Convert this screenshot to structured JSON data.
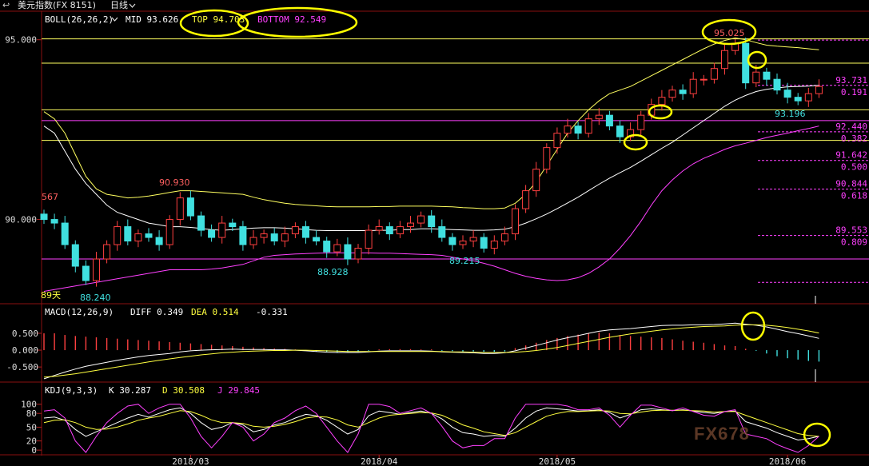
{
  "title_bar": {
    "back_glyph": "↩",
    "instrument": "美元指数(FX 8151)",
    "period": "日线",
    "period_chevron": "chevron-down-icon"
  },
  "watermark": "FX678",
  "chart_data": [
    {
      "type": "candlestick",
      "indicator": "BOLL(26,26,2)",
      "header": {
        "label": "BOLL(26,26,2)",
        "mid_label": "MID 93.626",
        "top_label": "TOP 94.703",
        "bottom_label": "BOTTOM 92.549"
      },
      "y_ticks": [
        "95.000",
        "90.000"
      ],
      "y_tick_values": [
        95.0,
        90.0
      ],
      "ylim": [
        87.7,
        95.75
      ],
      "x_ticks": [
        "2018/03",
        "2018/04",
        "2018/05",
        "2018/06"
      ],
      "x_tick_index": [
        14,
        32,
        49,
        71
      ],
      "bar_count": 75,
      "annotations": [
        {
          "text": "567",
          "value": 89.567,
          "color": "#ff6060"
        },
        {
          "text": "90.930",
          "value": 90.93,
          "color": "#ff6060"
        },
        {
          "text": "88.240",
          "value": 88.24,
          "color": "#40e0e0"
        },
        {
          "text": "88.928",
          "value": 88.928,
          "color": "#40e0e0"
        },
        {
          "text": "89.215",
          "value": 89.215,
          "color": "#40e0e0"
        },
        {
          "text": "95.025",
          "value": 95.025,
          "color": "#ff6060"
        },
        {
          "text": "93.196",
          "value": 93.196,
          "color": "#40e0e0"
        },
        {
          "text": "89天",
          "color": "#ffff40"
        }
      ],
      "horizontal_lines": [
        {
          "value": 95.025,
          "color": "#ffff60"
        },
        {
          "value": 94.35,
          "color": "#ffff60"
        },
        {
          "value": 93.05,
          "color": "#ffff60"
        },
        {
          "value": 92.75,
          "color": "#ff40ff"
        },
        {
          "value": 92.2,
          "color": "#ffff60"
        },
        {
          "value": 88.9,
          "color": "#ff40ff"
        }
      ],
      "fib_levels": [
        {
          "price": "93.731",
          "ratio": "0.191",
          "value": 93.731
        },
        {
          "price": "92.440",
          "ratio": "0.382",
          "value": 92.44
        },
        {
          "price": "91.642",
          "ratio": "0.500",
          "value": 91.642
        },
        {
          "price": "90.844",
          "ratio": "0.618",
          "value": 90.844
        },
        {
          "price": "89.553",
          "ratio": "0.809",
          "value": 89.553
        }
      ],
      "closes": [
        90.0,
        89.9,
        89.3,
        88.7,
        88.3,
        88.9,
        89.3,
        89.8,
        89.4,
        89.6,
        89.5,
        89.3,
        90.0,
        90.6,
        90.1,
        89.7,
        89.5,
        89.9,
        89.8,
        89.3,
        89.5,
        89.6,
        89.4,
        89.6,
        89.8,
        89.5,
        89.4,
        89.1,
        89.3,
        88.9,
        89.2,
        89.7,
        89.8,
        89.6,
        89.8,
        89.9,
        90.1,
        89.8,
        89.5,
        89.3,
        89.4,
        89.5,
        89.2,
        89.4,
        89.6,
        90.3,
        90.8,
        91.4,
        92.0,
        92.4,
        92.6,
        92.4,
        92.8,
        92.9,
        92.6,
        92.3,
        92.5,
        92.9,
        93.2,
        93.4,
        93.6,
        93.5,
        93.9,
        93.9,
        94.2,
        94.7,
        94.9,
        93.8,
        94.1,
        93.9,
        93.6,
        93.4,
        93.3,
        93.5,
        93.7
      ],
      "mid_band": [
        92.6,
        92.4,
        91.9,
        91.4,
        91.0,
        90.7,
        90.4,
        90.2,
        90.1,
        90.0,
        89.9,
        89.85,
        89.8,
        89.8,
        89.78,
        89.75,
        89.72,
        89.7,
        89.72,
        89.74,
        89.76,
        89.77,
        89.77,
        89.76,
        89.74,
        89.72,
        89.7,
        89.69,
        89.69,
        89.69,
        89.69,
        89.69,
        89.7,
        89.7,
        89.72,
        89.72,
        89.74,
        89.74,
        89.73,
        89.72,
        89.71,
        89.7,
        89.7,
        89.71,
        89.73,
        89.8,
        89.9,
        90.02,
        90.15,
        90.3,
        90.46,
        90.62,
        90.8,
        90.98,
        91.15,
        91.3,
        91.45,
        91.62,
        91.8,
        91.98,
        92.15,
        92.35,
        92.55,
        92.75,
        92.95,
        93.15,
        93.32,
        93.45,
        93.56,
        93.62,
        93.66,
        93.69,
        93.7,
        93.71,
        93.73
      ],
      "upper_band": [
        93.0,
        92.8,
        92.4,
        91.8,
        91.2,
        90.85,
        90.7,
        90.65,
        90.6,
        90.62,
        90.65,
        90.7,
        90.75,
        90.8,
        90.8,
        90.78,
        90.76,
        90.74,
        90.72,
        90.7,
        90.62,
        90.55,
        90.5,
        90.45,
        90.42,
        90.4,
        90.38,
        90.36,
        90.35,
        90.35,
        90.35,
        90.35,
        90.36,
        90.36,
        90.37,
        90.37,
        90.37,
        90.37,
        90.36,
        90.35,
        90.33,
        90.32,
        90.3,
        90.3,
        90.32,
        90.45,
        90.7,
        91.05,
        91.5,
        91.95,
        92.4,
        92.75,
        93.05,
        93.3,
        93.5,
        93.6,
        93.7,
        93.85,
        94.0,
        94.15,
        94.3,
        94.45,
        94.6,
        94.75,
        94.88,
        94.98,
        95.05,
        95.0,
        94.92,
        94.85,
        94.82,
        94.8,
        94.78,
        94.75,
        94.72
      ],
      "lower_band": [
        88.0,
        88.05,
        88.1,
        88.15,
        88.2,
        88.25,
        88.3,
        88.35,
        88.4,
        88.45,
        88.5,
        88.55,
        88.6,
        88.6,
        88.6,
        88.6,
        88.62,
        88.65,
        88.7,
        88.75,
        88.85,
        88.95,
        89.0,
        89.02,
        89.04,
        89.05,
        89.06,
        89.07,
        89.07,
        89.07,
        89.07,
        89.07,
        89.06,
        89.06,
        89.05,
        89.04,
        89.03,
        89.02,
        89.0,
        88.95,
        88.9,
        88.85,
        88.78,
        88.7,
        88.6,
        88.5,
        88.42,
        88.36,
        88.32,
        88.3,
        88.32,
        88.38,
        88.5,
        88.68,
        88.9,
        89.2,
        89.55,
        89.95,
        90.4,
        90.8,
        91.1,
        91.35,
        91.55,
        91.7,
        91.82,
        91.95,
        92.05,
        92.12,
        92.2,
        92.28,
        92.34,
        92.4,
        92.47,
        92.53,
        92.6
      ]
    },
    {
      "type": "line",
      "indicator": "MACD(12,26,9)",
      "header": {
        "label": "MACD(12,26,9)",
        "diff_label": "DIFF 0.349",
        "dea_label": "DEA 0.514",
        "macd_label": "-0.331"
      },
      "y_ticks": [
        "0.500",
        "0.000",
        "-0.500"
      ],
      "y_tick_values": [
        0.5,
        0.0,
        -0.5
      ],
      "ylim": [
        -0.9,
        0.95
      ],
      "series": [
        {
          "name": "DIFF",
          "color": "#ffffff",
          "values": [
            -0.85,
            -0.75,
            -0.65,
            -0.56,
            -0.48,
            -0.42,
            -0.36,
            -0.3,
            -0.25,
            -0.2,
            -0.16,
            -0.13,
            -0.1,
            -0.05,
            -0.02,
            0.0,
            0.01,
            0.02,
            0.03,
            0.02,
            0.02,
            0.02,
            0.01,
            0.01,
            0.0,
            -0.02,
            -0.04,
            -0.06,
            -0.07,
            -0.07,
            -0.07,
            -0.05,
            -0.03,
            -0.02,
            -0.02,
            -0.02,
            -0.02,
            -0.03,
            -0.05,
            -0.06,
            -0.07,
            -0.08,
            -0.1,
            -0.1,
            -0.08,
            -0.02,
            0.06,
            0.14,
            0.22,
            0.3,
            0.37,
            0.43,
            0.5,
            0.56,
            0.6,
            0.62,
            0.64,
            0.67,
            0.7,
            0.73,
            0.74,
            0.74,
            0.75,
            0.75,
            0.76,
            0.78,
            0.8,
            0.77,
            0.74,
            0.69,
            0.62,
            0.55,
            0.49,
            0.42,
            0.35
          ]
        },
        {
          "name": "DEA",
          "color": "#ffff40",
          "values": [
            -0.8,
            -0.78,
            -0.74,
            -0.7,
            -0.65,
            -0.6,
            -0.55,
            -0.5,
            -0.45,
            -0.4,
            -0.35,
            -0.3,
            -0.26,
            -0.22,
            -0.18,
            -0.14,
            -0.11,
            -0.08,
            -0.06,
            -0.04,
            -0.03,
            -0.02,
            -0.01,
            -0.01,
            0.0,
            0.0,
            -0.01,
            -0.02,
            -0.03,
            -0.04,
            -0.04,
            -0.04,
            -0.04,
            -0.04,
            -0.04,
            -0.04,
            -0.04,
            -0.04,
            -0.04,
            -0.05,
            -0.05,
            -0.06,
            -0.07,
            -0.07,
            -0.07,
            -0.06,
            -0.04,
            -0.01,
            0.03,
            0.08,
            0.14,
            0.2,
            0.26,
            0.32,
            0.38,
            0.43,
            0.48,
            0.52,
            0.56,
            0.6,
            0.63,
            0.66,
            0.68,
            0.7,
            0.71,
            0.72,
            0.74,
            0.75,
            0.75,
            0.74,
            0.71,
            0.67,
            0.62,
            0.57,
            0.51
          ]
        }
      ],
      "histogram": [
        0.5,
        0.5,
        0.45,
        0.42,
        0.4,
        0.38,
        0.36,
        0.34,
        0.32,
        0.3,
        0.28,
        0.26,
        0.24,
        0.22,
        0.2,
        0.18,
        0.16,
        0.14,
        0.12,
        0.1,
        0.08,
        0.06,
        0.05,
        0.04,
        0.02,
        -0.02,
        -0.04,
        -0.05,
        -0.06,
        -0.05,
        -0.04,
        -0.02,
        0.02,
        0.03,
        0.03,
        0.03,
        0.02,
        0.02,
        -0.02,
        -0.03,
        -0.04,
        -0.04,
        -0.05,
        -0.05,
        -0.04,
        0.06,
        0.14,
        0.22,
        0.3,
        0.36,
        0.42,
        0.46,
        0.5,
        0.52,
        0.5,
        0.45,
        0.42,
        0.4,
        0.38,
        0.36,
        0.32,
        0.28,
        0.25,
        0.22,
        0.18,
        0.14,
        0.12,
        0.04,
        -0.02,
        -0.1,
        -0.18,
        -0.24,
        -0.28,
        -0.32,
        -0.34
      ]
    },
    {
      "type": "line",
      "indicator": "KDJ(9,3,3)",
      "header": {
        "label": "KDJ(9,3,3)",
        "k_label": "K 30.287",
        "d_label": "D 30.508",
        "j_label": "J 29.845"
      },
      "y_ticks": [
        "100",
        "80",
        "50",
        "20",
        "0"
      ],
      "y_tick_values": [
        100,
        80,
        50,
        20,
        0
      ],
      "ylim": [
        -5,
        110
      ],
      "series": [
        {
          "name": "K",
          "color": "#ffffff",
          "values": [
            70,
            72,
            65,
            45,
            30,
            40,
            50,
            60,
            70,
            78,
            72,
            80,
            88,
            92,
            80,
            60,
            45,
            50,
            60,
            55,
            40,
            45,
            55,
            60,
            70,
            78,
            75,
            65,
            50,
            35,
            45,
            75,
            85,
            82,
            78,
            82,
            85,
            80,
            68,
            50,
            38,
            35,
            30,
            32,
            30,
            48,
            70,
            85,
            92,
            90,
            88,
            85,
            86,
            88,
            82,
            70,
            78,
            88,
            90,
            88,
            86,
            88,
            85,
            82,
            80,
            84,
            85,
            62,
            55,
            48,
            38,
            30,
            22,
            25,
            30
          ]
        },
        {
          "name": "D",
          "color": "#ffff40",
          "values": [
            60,
            65,
            66,
            60,
            50,
            45,
            46,
            50,
            57,
            65,
            70,
            74,
            80,
            86,
            84,
            76,
            66,
            60,
            60,
            58,
            52,
            50,
            52,
            56,
            62,
            70,
            73,
            72,
            66,
            55,
            50,
            60,
            70,
            76,
            78,
            80,
            82,
            81,
            76,
            66,
            55,
            48,
            40,
            36,
            32,
            38,
            50,
            62,
            74,
            80,
            84,
            84,
            85,
            86,
            85,
            80,
            79,
            83,
            86,
            87,
            87,
            87,
            86,
            85,
            83,
            84,
            84,
            76,
            68,
            60,
            52,
            44,
            36,
            32,
            30
          ]
        },
        {
          "name": "J",
          "color": "#ff40ff",
          "values": [
            85,
            88,
            70,
            20,
            -5,
            30,
            60,
            80,
            96,
            100,
            80,
            92,
            100,
            100,
            70,
            30,
            5,
            30,
            60,
            50,
            20,
            35,
            60,
            70,
            86,
            96,
            80,
            50,
            20,
            -5,
            35,
            100,
            100,
            95,
            80,
            86,
            92,
            80,
            52,
            20,
            5,
            10,
            10,
            25,
            25,
            70,
            100,
            100,
            100,
            100,
            96,
            88,
            88,
            92,
            76,
            50,
            76,
            98,
            98,
            92,
            86,
            92,
            84,
            76,
            74,
            84,
            88,
            35,
            30,
            25,
            12,
            3,
            -5,
            10,
            30
          ]
        }
      ]
    }
  ]
}
